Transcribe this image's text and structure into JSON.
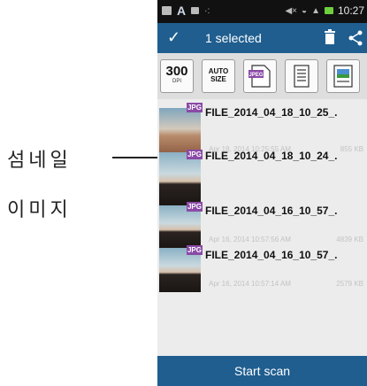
{
  "annotation": {
    "line1": "섬네일",
    "line2": "이미지"
  },
  "statusbar": {
    "letter": "A",
    "time": "10:27"
  },
  "actionbar": {
    "title": "1 selected"
  },
  "toolbar": {
    "dpi_value": "300",
    "dpi_label": "DPI",
    "autosize_line1": "AUTO",
    "autosize_line2": "SIZE",
    "jpeg_label": "JPEG"
  },
  "files": [
    {
      "name": "FILE_2014_04_18_10_25_.",
      "date": "Apr 18, 2014 10:25:55 AM",
      "size": "855 KB",
      "badge": "JPG"
    },
    {
      "name": "FILE_2014_04_18_10_24_.",
      "date": "",
      "size": "",
      "badge": "JPG"
    },
    {
      "name": "FILE_2014_04_16_10_57_.",
      "date": "Apr 16, 2014 10:57:56 AM",
      "size": "4839 KB",
      "badge": "JPG"
    },
    {
      "name": "FILE_2014_04_16_10_57_.",
      "date": "Apr 16, 2014 10:57:14 AM",
      "size": "2579 KB",
      "badge": "JPG"
    }
  ],
  "scan_button": {
    "label": "Start scan"
  },
  "colors": {
    "actionbar": "#1f5e8f",
    "badge": "#8a4aa6"
  }
}
